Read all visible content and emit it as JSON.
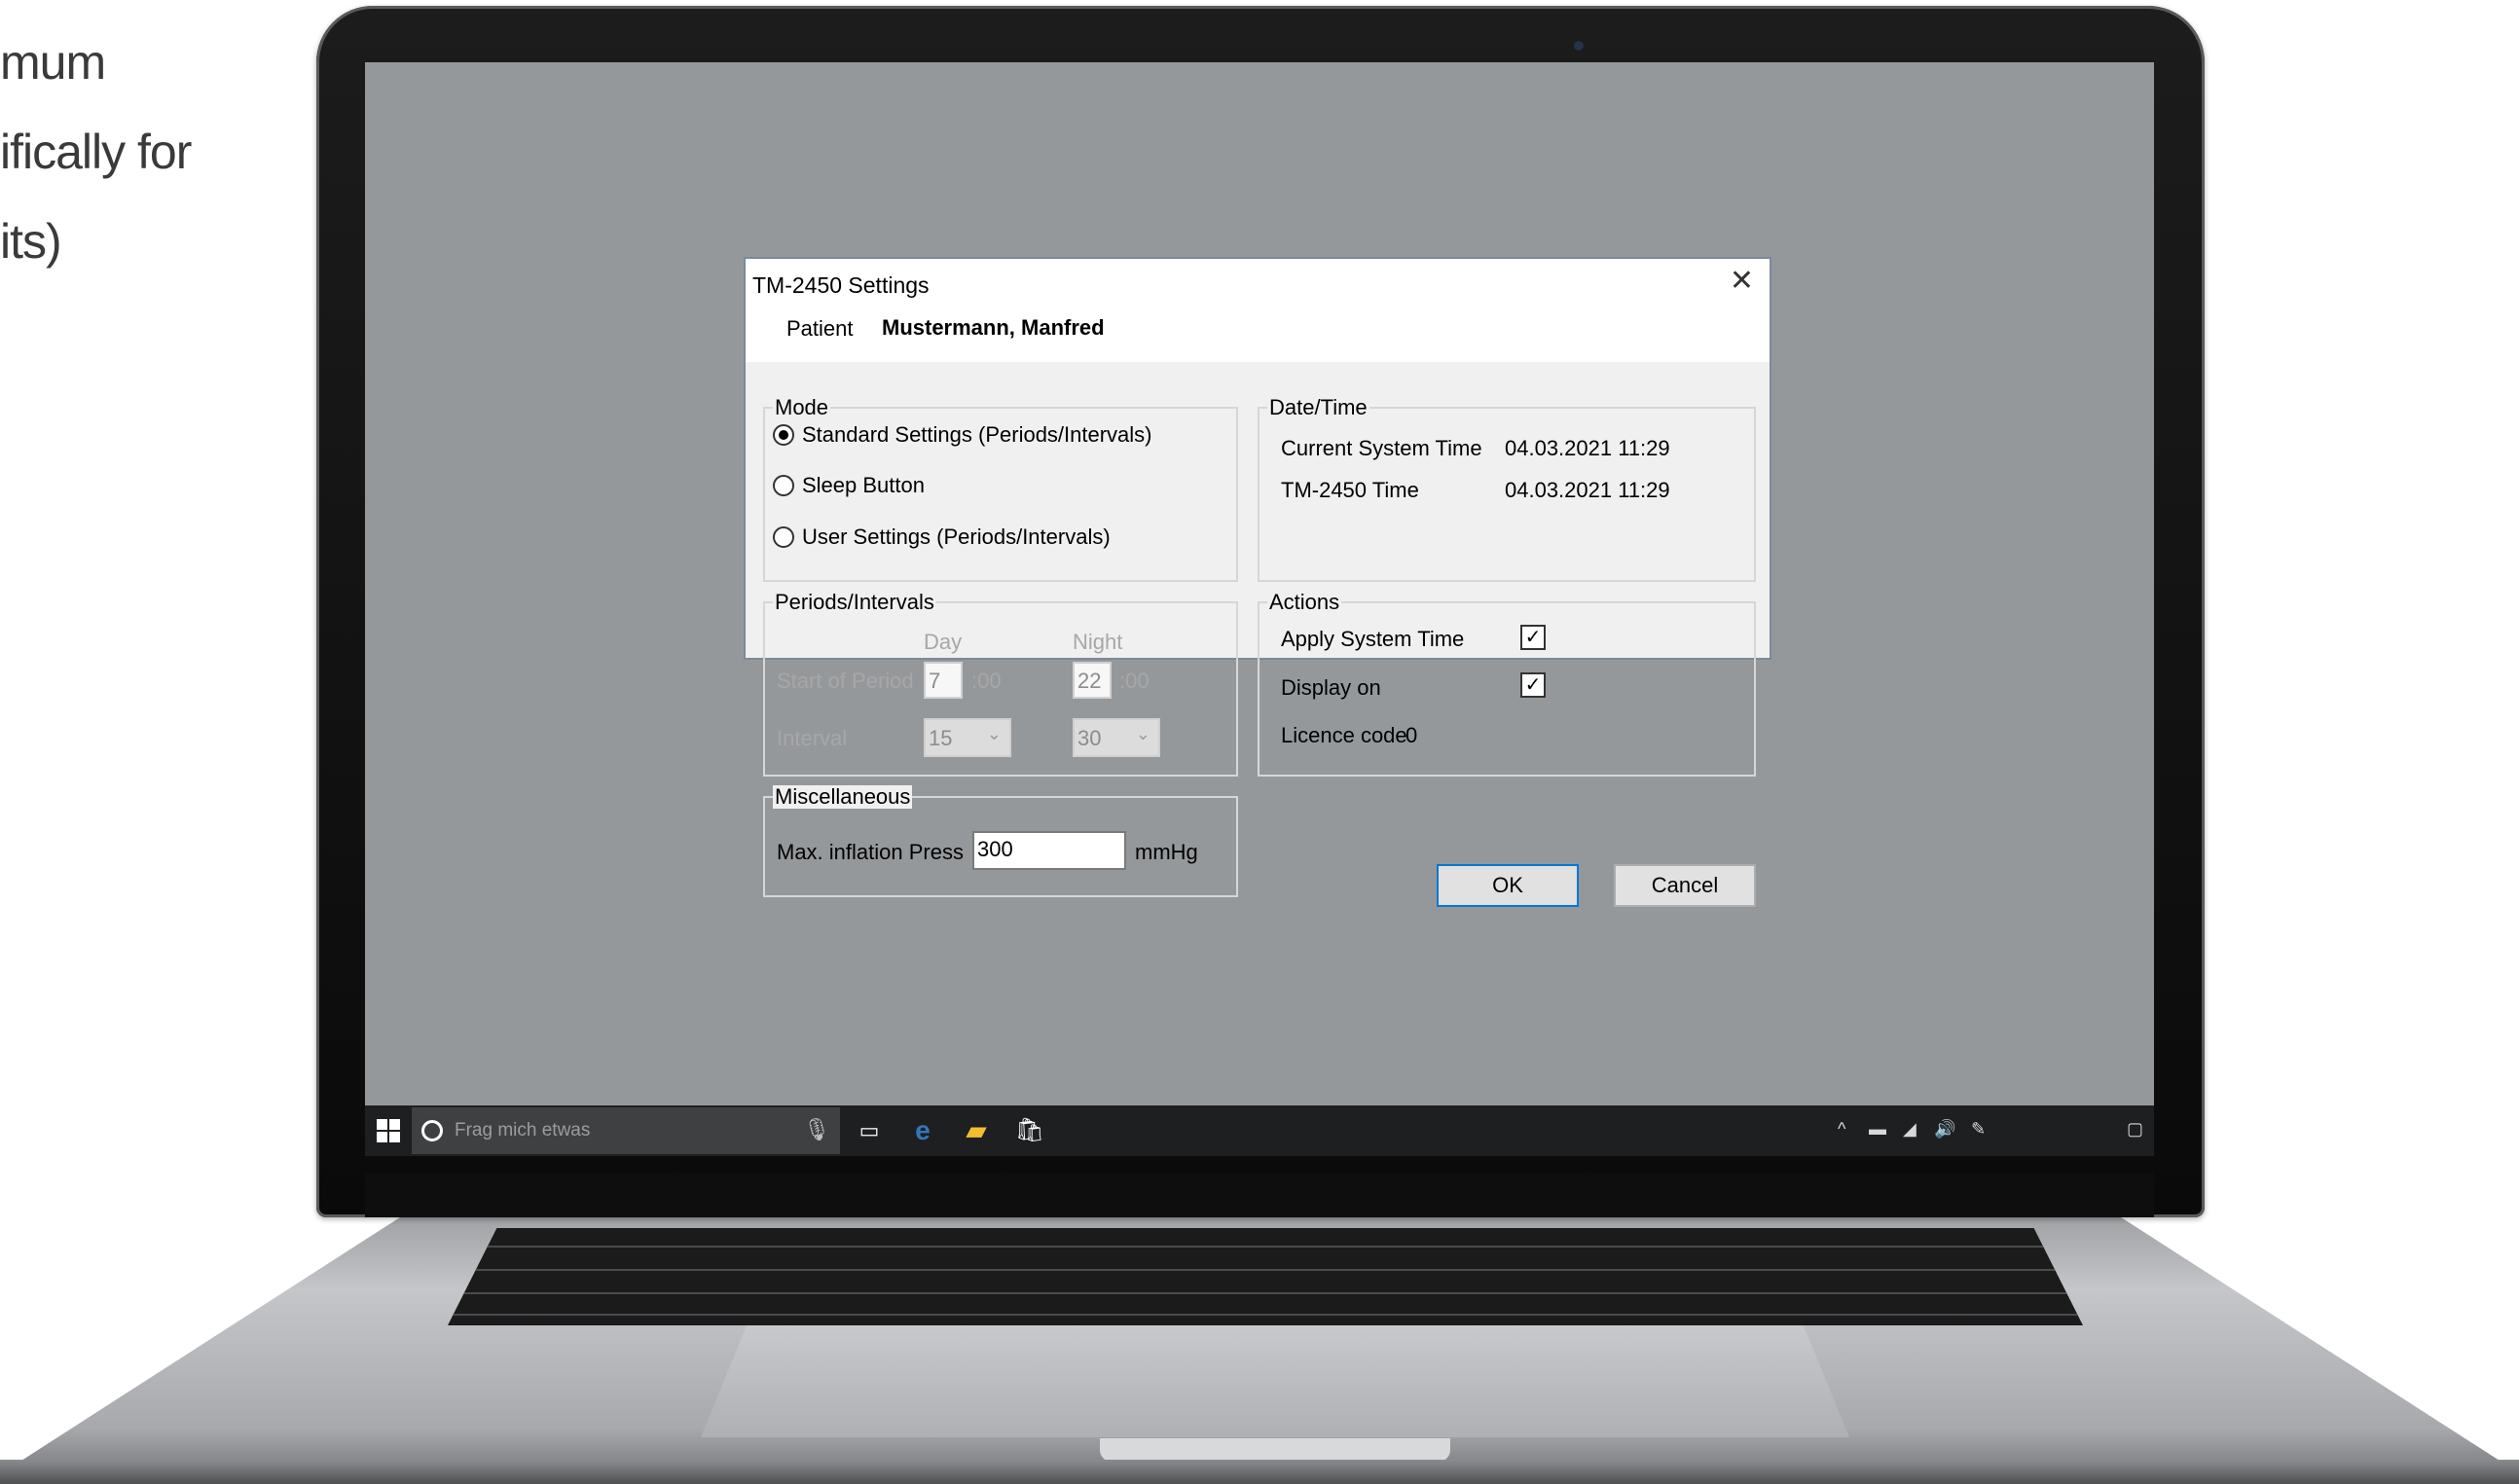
{
  "marketing": {
    "lines": [
      "mum",
      "ifically for",
      "its)"
    ]
  },
  "dialog": {
    "title": "TM-2450 Settings",
    "close_glyph": "✕",
    "patient_label": "Patient",
    "patient_name": "Mustermann, Manfred",
    "mode": {
      "label": "Mode",
      "options": [
        "Standard Settings (Periods/Intervals)",
        "Sleep Button",
        "User Settings (Periods/Intervals)"
      ],
      "selected_index": 0
    },
    "datetime": {
      "label": "Date/Time",
      "current_label": "Current System Time",
      "current_value": "04.03.2021 11:29",
      "device_label": "TM-2450 Time",
      "device_value": "04.03.2021 11:29"
    },
    "periods": {
      "label": "Periods/Intervals",
      "day_header": "Day",
      "night_header": "Night",
      "start_label": "Start of Period",
      "day_start": "7",
      "night_start": "22",
      "suffix": ":00",
      "interval_label": "Interval",
      "day_interval": "15",
      "night_interval": "30"
    },
    "actions": {
      "label": "Actions",
      "apply_time_label": "Apply System Time",
      "apply_time_checked": true,
      "display_on_label": "Display on",
      "display_on_checked": true,
      "licence_label": "Licence code",
      "licence_value": "0"
    },
    "misc": {
      "label": "Miscellaneous",
      "max_press_label": "Max. inflation Press",
      "max_press_value": "300",
      "unit": "mmHg"
    },
    "ok_label": "OK",
    "cancel_label": "Cancel",
    "check_glyph": "✓",
    "combo_arrow": "⌄"
  },
  "taskbar": {
    "search_placeholder": "Frag mich etwas",
    "icons": [
      "windows-start-icon",
      "cortana-icon",
      "microphone-icon",
      "task-view-icon",
      "edge-icon",
      "file-explorer-icon",
      "store-icon",
      "chevron-up-icon",
      "battery-icon",
      "network-icon",
      "volume-icon",
      "pen-icon",
      "notification-icon"
    ]
  }
}
